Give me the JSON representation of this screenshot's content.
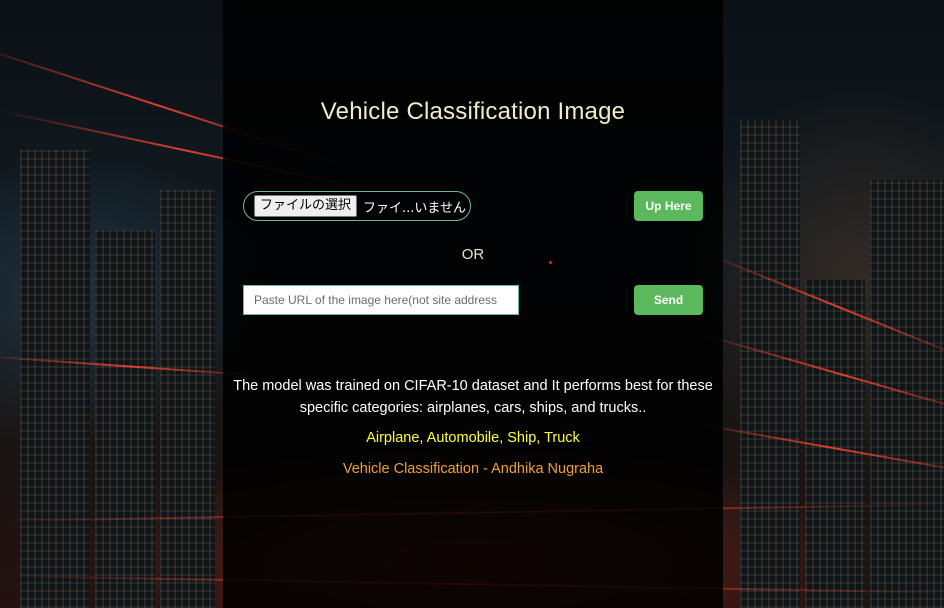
{
  "header": {
    "title": "Vehicle Classification Image"
  },
  "upload": {
    "file_button_label": "ファイルの選択",
    "file_status": "ファイ...いません",
    "upload_button_label": "Up Here"
  },
  "divider": {
    "or_label": "OR"
  },
  "url_form": {
    "placeholder": "Paste URL of the image here(not site address",
    "value": "",
    "send_button_label": "Send"
  },
  "info": {
    "description": "The model was trained on CIFAR-10 dataset and It performs best for these specific categories: airplanes, cars, ships, and trucks..",
    "categories": "Airplane, Automobile, Ship, Truck",
    "credit": "Vehicle Classification - Andhika Nugraha"
  },
  "colors": {
    "title": "#f3ecc8",
    "button_green": "#5cb85c",
    "categories_yellow": "#ffff33",
    "credit_orange": "#f0a02a"
  },
  "background": {
    "description_icon": "city-night-light-trails-icon"
  }
}
